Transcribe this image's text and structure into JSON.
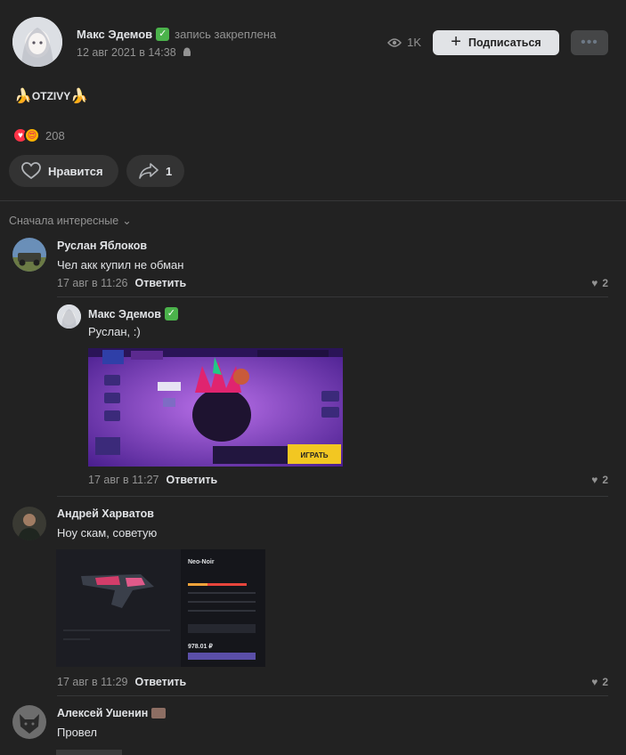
{
  "post": {
    "author": "Макс Эдемов",
    "pinned": "запись закреплена",
    "date": "12 авг 2021 в 14:38",
    "views": "1K",
    "subscribe": "Подписаться",
    "text": "OTZIVY",
    "reactions_count": "208",
    "like_label": "Нравится",
    "share_count": "1"
  },
  "sort": {
    "label": "Сначала интересные"
  },
  "comments": [
    {
      "author": "Руслан Яблоков",
      "text": "Чел акк купил не обман",
      "date": "17 авг в 11:26",
      "reply": "Ответить",
      "likes": "2"
    },
    {
      "author": "Макс Эдемов",
      "text": "Руслан, :)",
      "date": "17 авг в 11:27",
      "reply": "Ответить",
      "likes": "2",
      "image": {
        "fight_label": "ИГРАТЬ"
      }
    },
    {
      "author": "Андрей Харватов",
      "text": "Ноу скам, советую",
      "date": "17 авг в 11:29",
      "reply": "Ответить",
      "likes": "2",
      "image": {
        "skin_title": "Neo-Noir",
        "price": "978.01 ₽"
      }
    },
    {
      "author": "Алексей Ушенин",
      "text": "Провел"
    }
  ],
  "colors": {
    "background": "#222222",
    "button": "#333333",
    "verified": "#4bb34b",
    "text_secondary": "#939393"
  }
}
